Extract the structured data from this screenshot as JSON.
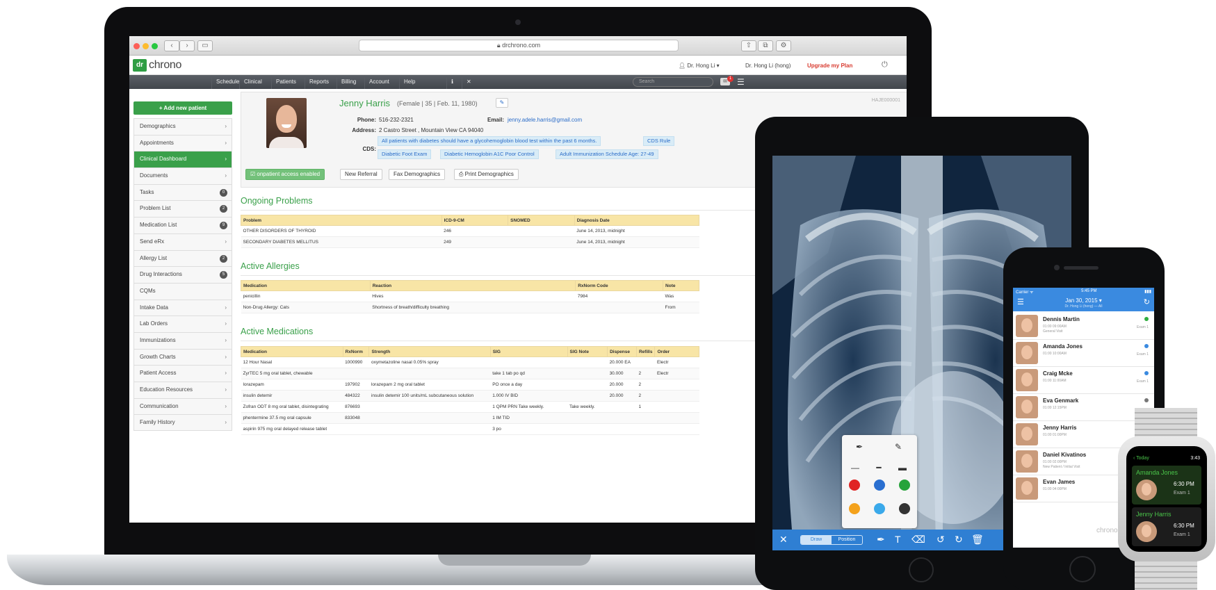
{
  "browser": {
    "url": "drchrono.com",
    "nav_back": "‹",
    "nav_forward": "›",
    "sidebar_toggle": "▭"
  },
  "app": {
    "logo_dr": "dr",
    "logo_text": "chrono",
    "user_menu": "Dr. Hong Li ▾",
    "user_name_full": "Dr. Hong Li (hong)",
    "upgrade_label": "Upgrade my Plan",
    "search_placeholder": "Search",
    "message_count": "1",
    "nav": [
      "Schedule",
      "Clinical",
      "Patients",
      "Reports",
      "Billing",
      "Account",
      "Help"
    ]
  },
  "sidebar": {
    "add_patient_label": "+ Add new patient",
    "items": [
      {
        "label": "Demographics",
        "type": "chevron"
      },
      {
        "label": "Appointments",
        "type": "chevron"
      },
      {
        "label": "Clinical Dashboard",
        "type": "chevron",
        "active": true
      },
      {
        "label": "Documents",
        "type": "chevron"
      },
      {
        "label": "Tasks",
        "type": "count",
        "count": "0"
      },
      {
        "label": "Problem List",
        "type": "count",
        "count": "2"
      },
      {
        "label": "Medication List",
        "type": "count",
        "count": "9"
      },
      {
        "label": "Send eRx",
        "type": "chevron"
      },
      {
        "label": "Allergy List",
        "type": "count",
        "count": "2"
      },
      {
        "label": "Drug Interactions",
        "type": "count",
        "count": "5"
      },
      {
        "label": "CQMs",
        "type": "none"
      },
      {
        "label": "Intake Data",
        "type": "chevron"
      },
      {
        "label": "Lab Orders",
        "type": "chevron"
      },
      {
        "label": "Immunizations",
        "type": "chevron"
      },
      {
        "label": "Growth Charts",
        "type": "chevron"
      },
      {
        "label": "Patient Access",
        "type": "chevron"
      },
      {
        "label": "Education Resources",
        "type": "chevron"
      },
      {
        "label": "Communication",
        "type": "chevron"
      },
      {
        "label": "Family History",
        "type": "chevron"
      }
    ]
  },
  "patient": {
    "name": "Jenny Harris",
    "info": "(Female | 35 | Feb. 11, 1980)",
    "id": "HAJE000001",
    "phone_label": "Phone:",
    "phone": "516-232-2321",
    "email_label": "Email:",
    "email": "jenny.adele.harris@gmail.com",
    "address_label": "Address:",
    "address": "2 Castro Street ,  Mountain View  CA  94040",
    "cds_label": "CDS:",
    "cds": [
      "All patients with diabetes should have a glycohemoglobin blood test within the past 6 months.",
      "CDS Rule",
      "Diabetic Foot Exam",
      "Diabetic Hemoglobin A1C Poor Control",
      "Adult Immunization Schedule Age: 27-49"
    ],
    "actions": [
      "☑ onpatient access enabled",
      "New Referral",
      "Fax Demographics",
      "⎙ Print Demographics"
    ]
  },
  "problems": {
    "title": "Ongoing Problems",
    "columns": [
      "Problem",
      "ICD-9-CM",
      "SNOMED",
      "Diagnosis Date"
    ],
    "rows": [
      [
        "OTHER DISORDERS OF THYROID",
        "246",
        "",
        "June 14, 2013, midnight"
      ],
      [
        "SECONDARY DIABETES MELLITUS",
        "249",
        "",
        "June 14, 2013, midnight"
      ]
    ]
  },
  "allergies": {
    "title": "Active Allergies",
    "columns": [
      "Medication",
      "Reaction",
      "RxNorm Code",
      "Note"
    ],
    "rows": [
      [
        "penicillin",
        "Hives",
        "7984",
        "Was"
      ],
      [
        "Non-Drug Allergy: Cats",
        "Shortness of breath/difficulty breathing",
        "",
        "From"
      ]
    ]
  },
  "medications": {
    "title": "Active Medications",
    "columns": [
      "Medication",
      "RxNorm",
      "Strength",
      "SIG",
      "SIG Note",
      "Dispense",
      "Refills",
      "Order"
    ],
    "rows": [
      [
        "12 Hour Nasal",
        "1000990",
        "oxymetazoline nasal 0.05% spray",
        "",
        "",
        "20.000 EA",
        "",
        "Electr"
      ],
      [
        "ZyrTEC 5 mg oral tablet, chewable",
        "",
        "",
        "take 1 tab po qd",
        "",
        "30.000",
        "2",
        "Electr"
      ],
      [
        "lorazepam",
        "197902",
        "lorazepam 2 mg oral tablet",
        "PO once a day",
        "",
        "20.000",
        "2",
        ""
      ],
      [
        "insulin detemir",
        "484322",
        "insulin detemir 100 units/mL subcutaneous solution",
        "1.000 IV BID",
        "",
        "20.000",
        "2",
        ""
      ],
      [
        "Zofran ODT 8 mg oral tablet, disintegrating",
        "876693",
        "",
        "1 QPM PRN Take weekly.",
        "Take weekly.",
        "",
        "1",
        ""
      ],
      [
        "phentermine 37.5 mg oral capsule",
        "833048",
        "",
        "1 IM TID",
        "",
        "",
        "",
        ""
      ],
      [
        "aspirin 975 mg oral delayed release tablet",
        "",
        "",
        "3 po",
        "",
        "",
        "",
        ""
      ]
    ]
  },
  "tablet": {
    "seg_draw": "Draw",
    "seg_position": "Position",
    "colors": [
      "#e02424",
      "#2a6fd0",
      "#26a33a",
      "#f4a21c",
      "#3aa9ea",
      "#333333"
    ]
  },
  "phone": {
    "status_left": "Carrier ᯤ",
    "status_time": "5:45 PM",
    "status_right": "▮▮▮",
    "date": "Jan 30, 2015 ▾",
    "sub": "Dr. Hong Li (hong) — All",
    "logo": "chrono",
    "patients": [
      {
        "name": "Dennis Martin",
        "time": "01:00 09:00AM",
        "visit": "General Visit",
        "exam": "Exam 1",
        "dot": "#2fae3f"
      },
      {
        "name": "Amanda Jones",
        "time": "01:00 10:00AM",
        "visit": "",
        "exam": "Exam 1",
        "dot": "#3a8ae0"
      },
      {
        "name": "Craig Mcke",
        "time": "01:00 11:00AM",
        "visit": "",
        "exam": "Exam 1",
        "dot": "#3a8ae0"
      },
      {
        "name": "Eva Genmark",
        "time": "01:00 12:15PM",
        "visit": "",
        "exam": "",
        "dot": "#777777"
      },
      {
        "name": "Jenny Harris",
        "time": "01:00 01:00PM",
        "visit": "",
        "exam": "",
        "dot": ""
      },
      {
        "name": "Daniel Kivatinos",
        "time": "01:00 02:00PM",
        "visit": "New Patient / Initial Visit",
        "exam": "",
        "dot": ""
      },
      {
        "name": "Evan James",
        "time": "01:00 04:00PM",
        "visit": "",
        "exam": "",
        "dot": ""
      }
    ]
  },
  "watch": {
    "header": "‹ Today",
    "time": "3:43",
    "cards": [
      {
        "name": "Amanda Jones",
        "time": "6:30 PM",
        "exam": "Exam 1"
      },
      {
        "name": "Jenny Harris",
        "time": "6:30 PM",
        "exam": "Exam 1"
      }
    ]
  }
}
